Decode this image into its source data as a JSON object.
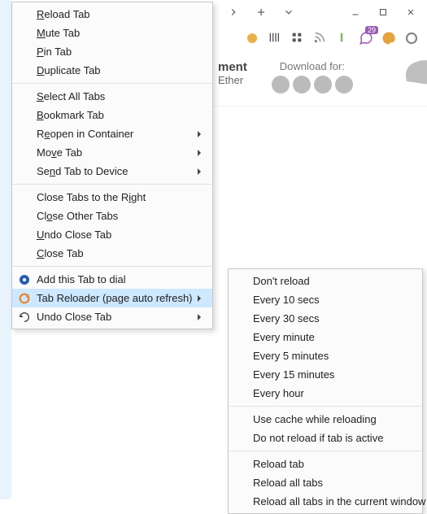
{
  "window": {
    "badge_count": "29"
  },
  "page": {
    "title_fragment": "ment",
    "subtitle_fragment": "Ether",
    "download_for": "Download for:"
  },
  "context_menu": {
    "items": [
      {
        "label": "Reload Tab",
        "mnemonic": "R"
      },
      {
        "label": "Mute Tab",
        "mnemonic": "M"
      },
      {
        "label": "Pin Tab",
        "mnemonic": "P"
      },
      {
        "label": "Duplicate Tab",
        "mnemonic": "D"
      },
      {
        "sep": true
      },
      {
        "label": "Select All Tabs",
        "mnemonic": "S"
      },
      {
        "label": "Bookmark Tab",
        "mnemonic": "B"
      },
      {
        "label": "Reopen in Container",
        "mnemonic": "e",
        "submenu": true
      },
      {
        "label": "Move Tab",
        "mnemonic": "v",
        "submenu": true
      },
      {
        "label": "Send Tab to Device",
        "mnemonic": "n",
        "submenu": true
      },
      {
        "sep": true
      },
      {
        "label": "Close Tabs to the Right",
        "mnemonic": "i"
      },
      {
        "label": "Close Other Tabs",
        "mnemonic": "o"
      },
      {
        "label": "Undo Close Tab",
        "mnemonic": "U"
      },
      {
        "label": "Close Tab",
        "mnemonic": "C"
      },
      {
        "sep": true
      },
      {
        "label": "Add this Tab to dial",
        "icon": "dial-icon"
      },
      {
        "label": "Tab Reloader (page auto refresh)",
        "icon": "reloader-icon",
        "submenu": true,
        "highlight": true
      },
      {
        "label": "Undo Close Tab",
        "icon": "undo-icon",
        "submenu": true
      }
    ]
  },
  "submenu": {
    "items": [
      {
        "label": "Don't reload"
      },
      {
        "label": "Every 10 secs"
      },
      {
        "label": "Every 30 secs"
      },
      {
        "label": "Every minute"
      },
      {
        "label": "Every 5 minutes"
      },
      {
        "label": "Every 15 minutes"
      },
      {
        "label": "Every hour"
      },
      {
        "sep": true
      },
      {
        "label": "Use cache while reloading"
      },
      {
        "label": "Do not reload if tab is active"
      },
      {
        "sep": true
      },
      {
        "label": "Reload tab"
      },
      {
        "label": "Reload all tabs"
      },
      {
        "label": "Reload all tabs in the current window"
      }
    ]
  }
}
